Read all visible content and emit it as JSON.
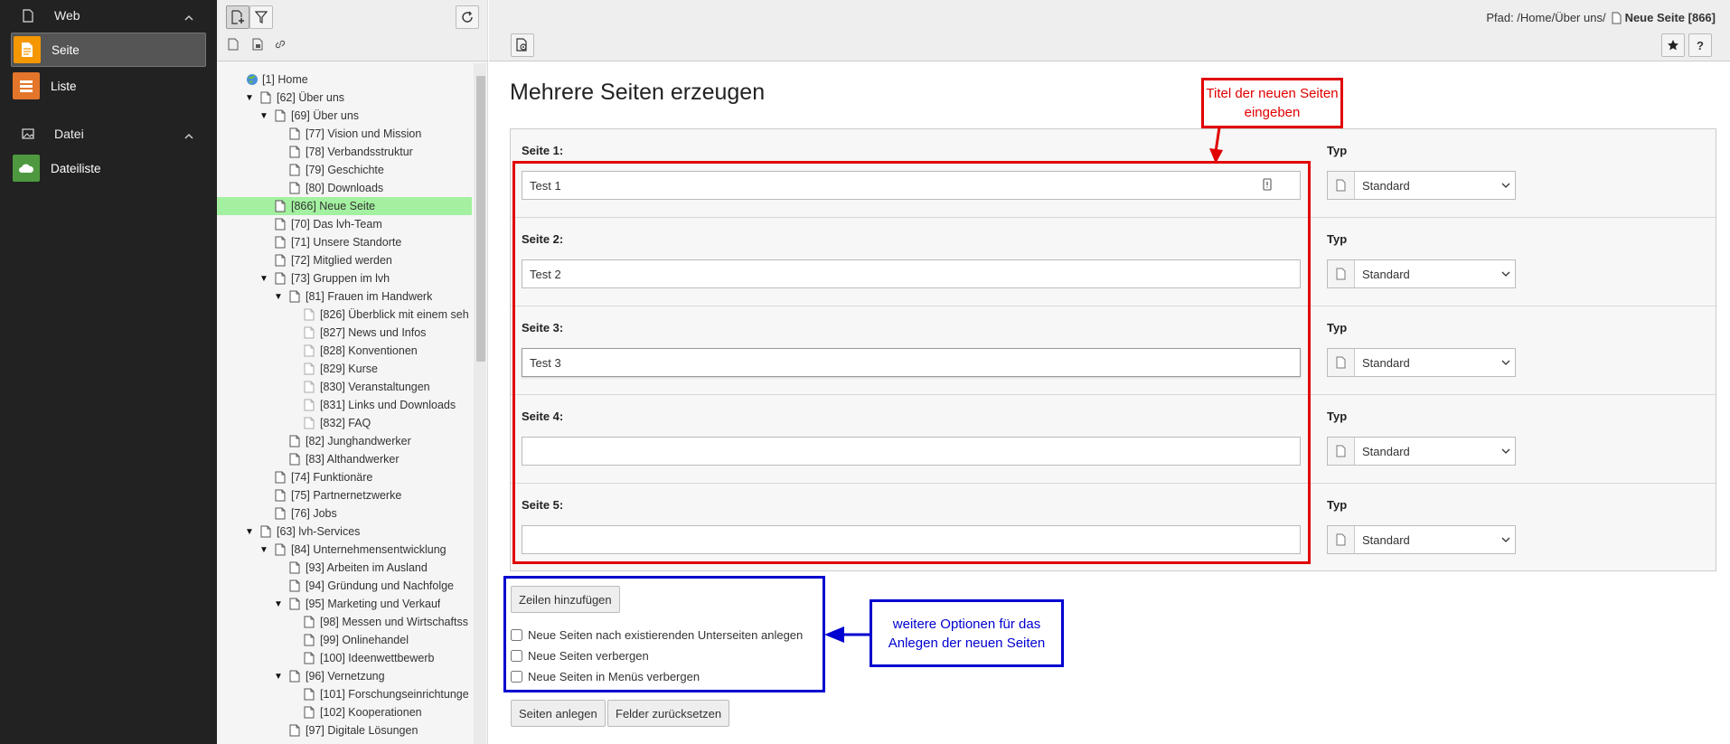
{
  "modmenu": {
    "web_label": "Web",
    "seite_label": "Seite",
    "liste_label": "Liste",
    "datei_label": "Datei",
    "dateiliste_label": "Dateiliste"
  },
  "tree": {
    "nodes": [
      {
        "label": "[1] Home",
        "indent": 0,
        "toggle": "",
        "type": "globe"
      },
      {
        "label": "[62] Über uns",
        "indent": 1,
        "toggle": "▼",
        "type": "page"
      },
      {
        "label": "[69] Über uns",
        "indent": 2,
        "toggle": "▼",
        "type": "page"
      },
      {
        "label": "[77] Vision und Mission",
        "indent": 3,
        "toggle": "",
        "type": "page"
      },
      {
        "label": "[78] Verbandsstruktur",
        "indent": 3,
        "toggle": "",
        "type": "page"
      },
      {
        "label": "[79] Geschichte",
        "indent": 3,
        "toggle": "",
        "type": "page"
      },
      {
        "label": "[80] Downloads",
        "indent": 3,
        "toggle": "",
        "type": "page"
      },
      {
        "label": "[866] Neue Seite",
        "indent": 2,
        "toggle": "",
        "type": "page",
        "selected": true
      },
      {
        "label": "[70] Das lvh-Team",
        "indent": 2,
        "toggle": "",
        "type": "page"
      },
      {
        "label": "[71] Unsere Standorte",
        "indent": 2,
        "toggle": "",
        "type": "page"
      },
      {
        "label": "[72] Mitglied werden",
        "indent": 2,
        "toggle": "",
        "type": "page"
      },
      {
        "label": "[73] Gruppen im lvh",
        "indent": 2,
        "toggle": "▼",
        "type": "page"
      },
      {
        "label": "[81] Frauen im Handwerk",
        "indent": 3,
        "toggle": "▼",
        "type": "page"
      },
      {
        "label": "[826] Überblick mit einem seh",
        "indent": 4,
        "toggle": "",
        "type": "pagelight"
      },
      {
        "label": "[827] News und Infos",
        "indent": 4,
        "toggle": "",
        "type": "pagelight"
      },
      {
        "label": "[828] Konventionen",
        "indent": 4,
        "toggle": "",
        "type": "pagelight"
      },
      {
        "label": "[829] Kurse",
        "indent": 4,
        "toggle": "",
        "type": "pagelight"
      },
      {
        "label": "[830] Veranstaltungen",
        "indent": 4,
        "toggle": "",
        "type": "pagelight"
      },
      {
        "label": "[831] Links und Downloads",
        "indent": 4,
        "toggle": "",
        "type": "pagelight"
      },
      {
        "label": "[832] FAQ",
        "indent": 4,
        "toggle": "",
        "type": "pagelight"
      },
      {
        "label": "[82] Junghandwerker",
        "indent": 3,
        "toggle": "",
        "type": "page"
      },
      {
        "label": "[83] Althandwerker",
        "indent": 3,
        "toggle": "",
        "type": "page"
      },
      {
        "label": "[74] Funktionäre",
        "indent": 2,
        "toggle": "",
        "type": "page"
      },
      {
        "label": "[75] Partnernetzwerke",
        "indent": 2,
        "toggle": "",
        "type": "page"
      },
      {
        "label": "[76] Jobs",
        "indent": 2,
        "toggle": "",
        "type": "page"
      },
      {
        "label": "[63] lvh-Services",
        "indent": 1,
        "toggle": "▼",
        "type": "page"
      },
      {
        "label": "[84] Unternehmensentwicklung",
        "indent": 2,
        "toggle": "▼",
        "type": "page"
      },
      {
        "label": "[93] Arbeiten im Ausland",
        "indent": 3,
        "toggle": "",
        "type": "page"
      },
      {
        "label": "[94] Gründung und Nachfolge",
        "indent": 3,
        "toggle": "",
        "type": "page"
      },
      {
        "label": "[95] Marketing und Verkauf",
        "indent": 3,
        "toggle": "▼",
        "type": "page"
      },
      {
        "label": "[98] Messen und Wirtschaftss",
        "indent": 4,
        "toggle": "",
        "type": "page"
      },
      {
        "label": "[99] Onlinehandel",
        "indent": 4,
        "toggle": "",
        "type": "page"
      },
      {
        "label": "[100] Ideenwettbewerb",
        "indent": 4,
        "toggle": "",
        "type": "page"
      },
      {
        "label": "[96] Vernetzung",
        "indent": 3,
        "toggle": "▼",
        "type": "page"
      },
      {
        "label": "[101] Forschungseinrichtunge",
        "indent": 4,
        "toggle": "",
        "type": "page"
      },
      {
        "label": "[102] Kooperationen",
        "indent": 4,
        "toggle": "",
        "type": "page"
      },
      {
        "label": "[97] Digitale Lösungen",
        "indent": 3,
        "toggle": "",
        "type": "page"
      }
    ]
  },
  "header": {
    "path_label": "Pfad: /Home/Über uns/",
    "current_page": "Neue Seite [866]"
  },
  "main": {
    "title": "Mehrere Seiten erzeugen",
    "type_label": "Typ",
    "rows": [
      {
        "label": "Seite 1:",
        "value": "Test 1",
        "type": "Standard"
      },
      {
        "label": "Seite 2:",
        "value": "Test 2",
        "type": "Standard"
      },
      {
        "label": "Seite 3:",
        "value": "Test 3",
        "type": "Standard"
      },
      {
        "label": "Seite 4:",
        "value": "",
        "type": "Standard"
      },
      {
        "label": "Seite 5:",
        "value": "",
        "type": "Standard"
      }
    ],
    "add_rows_button": "Zeilen hinzufügen",
    "options": [
      "Neue Seiten nach existierenden Unterseiten anlegen",
      "Neue Seiten verbergen",
      "Neue Seiten in Menüs verbergen"
    ],
    "create_button": "Seiten anlegen",
    "reset_button": "Felder zurücksetzen"
  },
  "annotations": {
    "red_note": "Titel der neuen Seiten eingeben",
    "blue_note": "weitere Optionen für das Anlegen der neuen Seiten"
  },
  "colors": {
    "modmenu_bg": "#222222",
    "seite_icon": "#f49700",
    "liste_icon": "#e3762b",
    "dateiliste_icon": "#4e9940",
    "tree_selected": "#a3f1a0",
    "annotation_red": "#e00000",
    "annotation_blue": "#0000d0"
  }
}
